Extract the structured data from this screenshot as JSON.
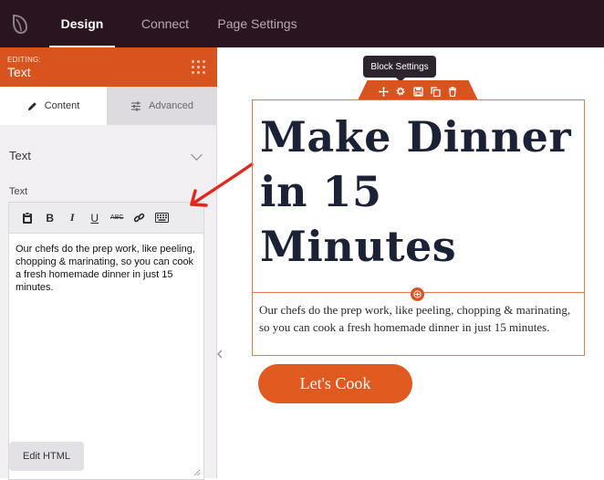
{
  "topbar": {
    "logo_icon": "seedprod-leaf-icon",
    "tabs": [
      {
        "label": "Design",
        "active": true
      },
      {
        "label": "Connect",
        "active": false
      },
      {
        "label": "Page Settings",
        "active": false
      }
    ]
  },
  "sidebar": {
    "editing_label": "EDITING:",
    "editing_title": "Text",
    "panel_tabs": [
      {
        "label": "Content",
        "icon": "pencil-icon",
        "active": true
      },
      {
        "label": "Advanced",
        "icon": "sliders-icon",
        "active": false
      }
    ],
    "section_title": "Text",
    "field_label": "Text",
    "toolbar": [
      "paste-icon",
      "bold-icon",
      "italic-icon",
      "underline-icon",
      "strikethrough-icon",
      "link-icon",
      "keyboard-icon"
    ],
    "toolbar_text": {
      "bold": "B",
      "italic": "I",
      "underline": "U",
      "strike": "ABC"
    },
    "editor_text": "Our chefs do the prep work, like peeling, chopping & marinating, so you can cook a fresh homemade dinner in just 15 minutes.",
    "edit_html_label": "Edit HTML"
  },
  "canvas": {
    "tooltip": "Block Settings",
    "block_icons": [
      "move-icon",
      "gear-icon",
      "save-icon",
      "duplicate-icon",
      "trash-icon"
    ],
    "headline": "Make Dinner in 15 Minutes",
    "paragraph": "Our chefs do the prep work, like peeling, chopping & marinating, so you can cook a fresh homemade dinner in just 15 minutes.",
    "cta_label": "Let's Cook"
  },
  "colors": {
    "accent": "#d9531e",
    "topbar": "#2a1420",
    "headline": "#1b2236",
    "arrow": "#e0281e"
  }
}
